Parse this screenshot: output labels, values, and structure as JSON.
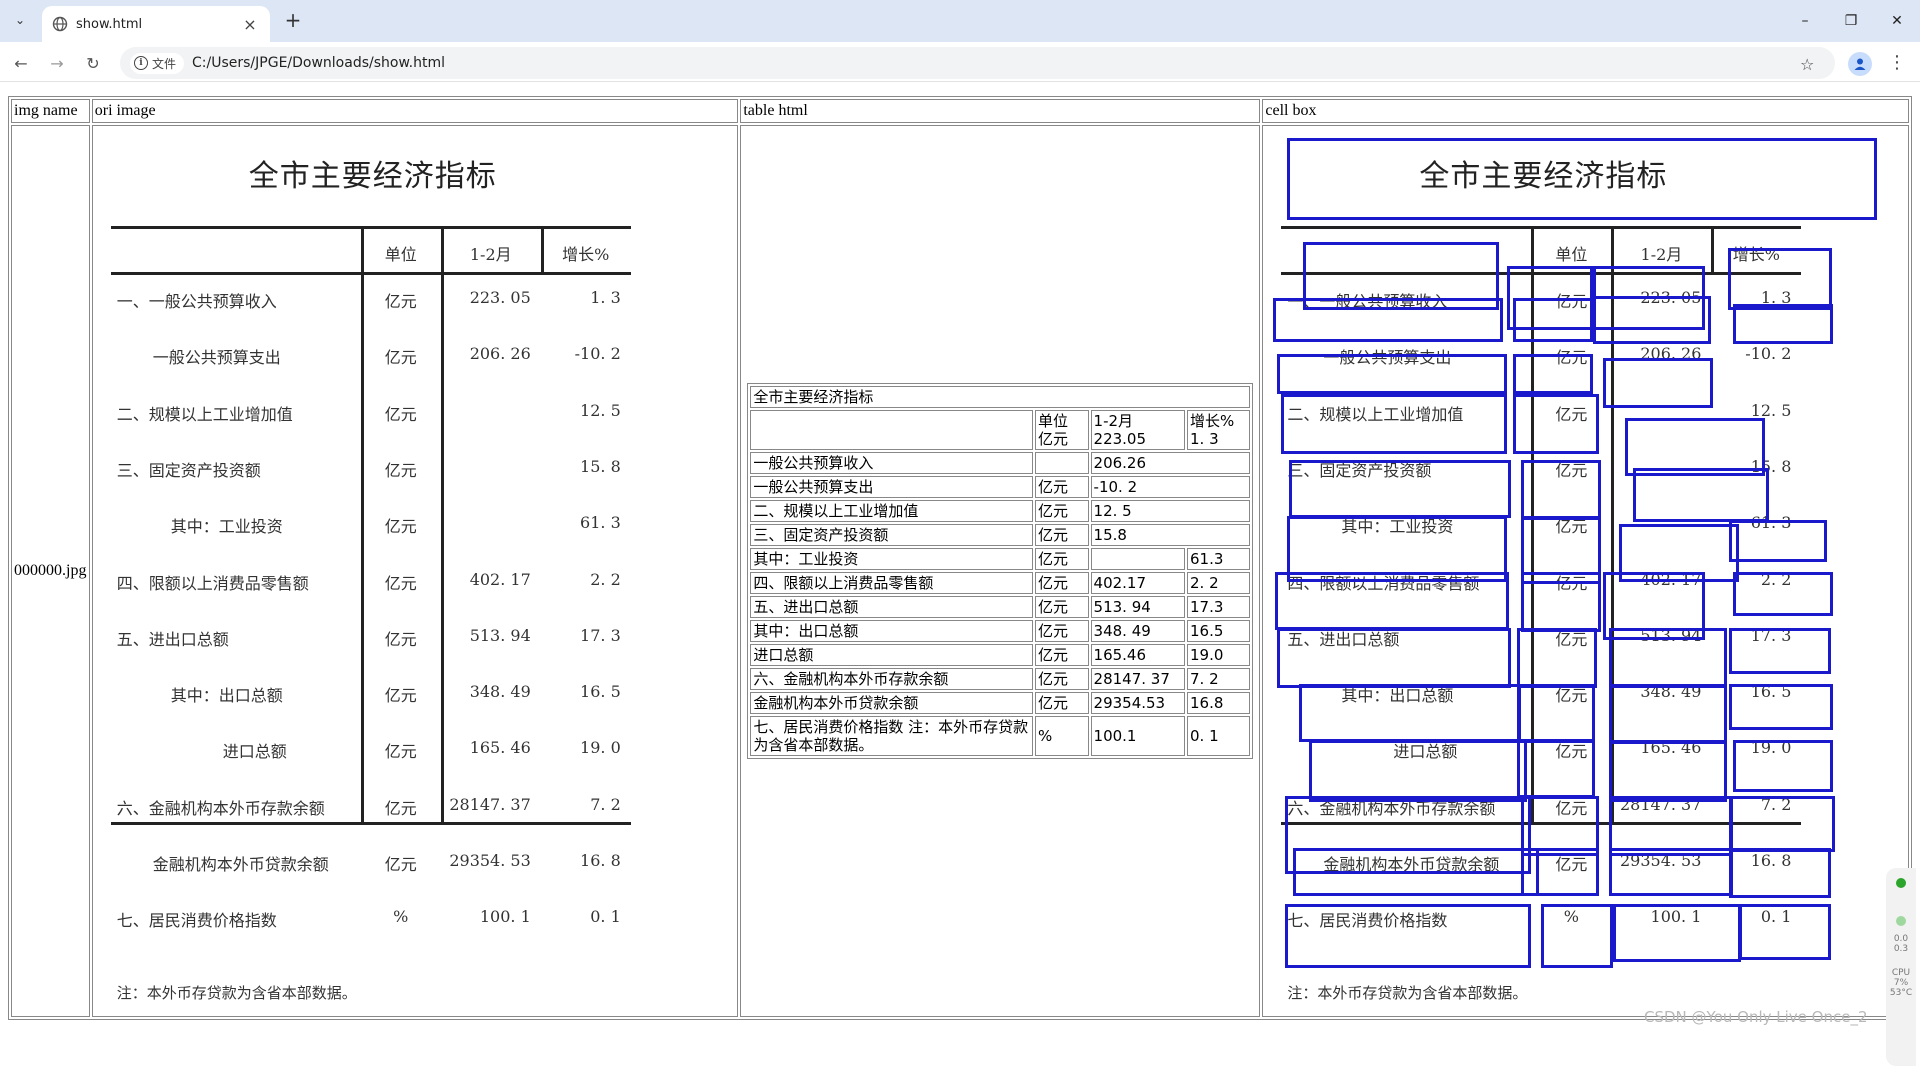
{
  "browser": {
    "tab_title": "show.html",
    "info_chip": "文件",
    "url": "C:/Users/JPGE/Downloads/show.html",
    "min_symbol": "–",
    "restore_symbol": "❐",
    "close_symbol": "✕",
    "newtab_symbol": "+",
    "tabclose_symbol": "×"
  },
  "table": {
    "headers": [
      "img name",
      "ori image",
      "table html",
      "cell box"
    ],
    "img_name": "000000.jpg"
  },
  "document": {
    "title": "全市主要经济指标",
    "col_headers": [
      "单位",
      "1-2月",
      "增长%"
    ],
    "rows": [
      {
        "label": "一、一般公共预算收入",
        "unit": "亿元",
        "value": "223. 05",
        "growth": "1. 3"
      },
      {
        "label": "一般公共预算支出",
        "unit": "亿元",
        "value": "206. 26",
        "growth": "-10. 2"
      },
      {
        "label": "二、规模以上工业增加值",
        "unit": "亿元",
        "value": "",
        "growth": "12. 5"
      },
      {
        "label": "三、固定资产投资额",
        "unit": "亿元",
        "value": "",
        "growth": "15. 8"
      },
      {
        "label": "其中：工业投资",
        "unit": "亿元",
        "value": "",
        "growth": "61. 3"
      },
      {
        "label": "四、限额以上消费品零售额",
        "unit": "亿元",
        "value": "402. 17",
        "growth": "2. 2"
      },
      {
        "label": "五、进出口总额",
        "unit": "亿元",
        "value": "513. 94",
        "growth": "17. 3"
      },
      {
        "label": "其中：出口总额",
        "unit": "亿元",
        "value": "348. 49",
        "growth": "16. 5"
      },
      {
        "label": "进口总额",
        "unit": "亿元",
        "value": "165. 46",
        "growth": "19. 0"
      },
      {
        "label": "六、金融机构本外币存款余额",
        "unit": "亿元",
        "value": "28147. 37",
        "growth": "7. 2"
      },
      {
        "label": "金融机构本外币贷款余额",
        "unit": "亿元",
        "value": "29354. 53",
        "growth": "16. 8"
      },
      {
        "label": "七、居民消费价格指数",
        "unit": "%",
        "value": "100. 1",
        "growth": "0. 1"
      }
    ],
    "note": "注：本外币存贷款为含省本部数据。"
  },
  "html_table": {
    "title": "全市主要经济指标",
    "header_row": [
      "",
      "单位\n亿元",
      "1-2月\n223.05",
      "增长%\n1. 3"
    ],
    "rows": [
      [
        "一般公共预算收入",
        "",
        "206.26",
        null
      ],
      [
        "一般公共预算支出",
        "亿元",
        "-10. 2",
        null
      ],
      [
        "二、规模以上工业增加值",
        "亿元",
        "12. 5",
        null
      ],
      [
        "三、固定资产投资额",
        "亿元",
        "15.8",
        null
      ],
      [
        "其中：工业投资",
        "亿元",
        "",
        "61.3"
      ],
      [
        "四、限额以上消费品零售额",
        "亿元",
        "402.17",
        "2. 2"
      ],
      [
        "五、进出口总额",
        "亿元",
        "513. 94",
        "17.3"
      ],
      [
        "其中：出口总额",
        "亿元",
        "348. 49",
        "16.5"
      ],
      [
        "进口总额",
        "亿元",
        "165.46",
        "19.0"
      ],
      [
        "六、金融机构本外币存款余额",
        "亿元",
        "28147. 37",
        "7. 2"
      ],
      [
        "金融机构本外币贷款余额",
        "亿元",
        "29354.53",
        "16.8"
      ],
      [
        "七、居民消费价格指数 注：本外币存贷款为含省本部数据。",
        "%",
        "100.1",
        "0. 1"
      ]
    ]
  },
  "watermark": "CSDN @You Only Live Once_2",
  "side_widget": [
    "0.0",
    "0.3",
    "CPU",
    "7%",
    "53°C"
  ]
}
